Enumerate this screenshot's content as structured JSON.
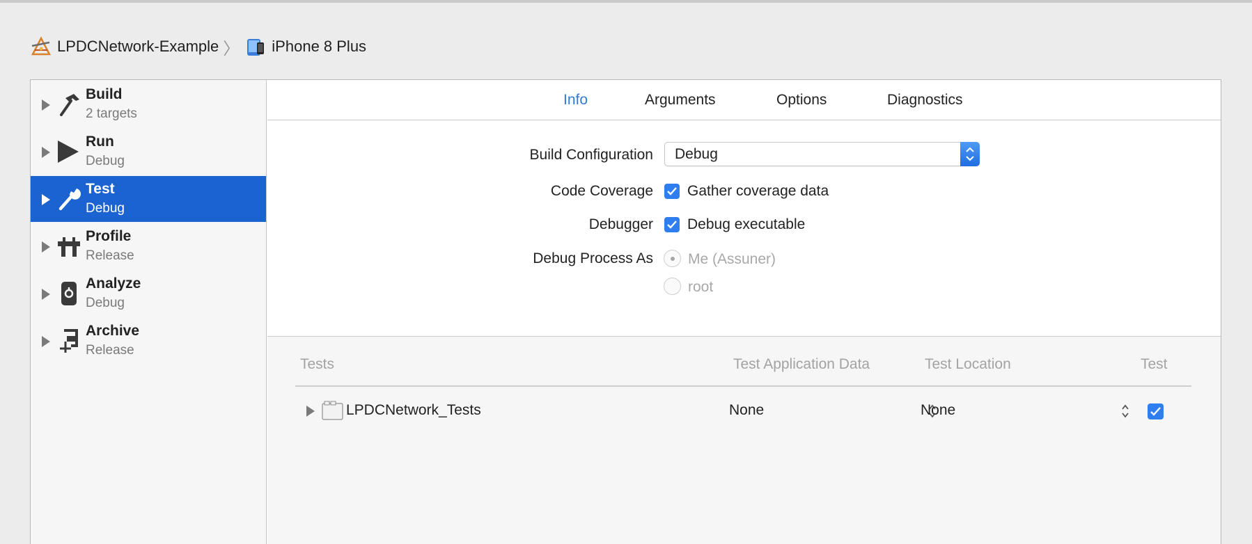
{
  "breadcrumb": {
    "project": "LPDCNetwork-Example",
    "separator": "〉",
    "device": "iPhone 8 Plus"
  },
  "sidebar": {
    "items": [
      {
        "name": "Build",
        "sub": "2 targets",
        "icon": "hammer-icon"
      },
      {
        "name": "Run",
        "sub": "Debug",
        "icon": "play-icon"
      },
      {
        "name": "Test",
        "sub": "Debug",
        "icon": "wrench-icon",
        "selected": true
      },
      {
        "name": "Profile",
        "sub": "Release",
        "icon": "caliper-icon"
      },
      {
        "name": "Analyze",
        "sub": "Debug",
        "icon": "analyze-icon"
      },
      {
        "name": "Archive",
        "sub": "Release",
        "icon": "clamp-icon"
      }
    ]
  },
  "tabs": [
    {
      "label": "Info",
      "active": true
    },
    {
      "label": "Arguments"
    },
    {
      "label": "Options"
    },
    {
      "label": "Diagnostics"
    }
  ],
  "info": {
    "build_configuration": {
      "label": "Build Configuration",
      "value": "Debug"
    },
    "code_coverage": {
      "label": "Code Coverage",
      "checkbox_label": "Gather coverage data",
      "checked": true
    },
    "debugger": {
      "label": "Debugger",
      "checkbox_label": "Debug executable",
      "checked": true
    },
    "debug_process_as": {
      "label": "Debug Process As",
      "options": [
        {
          "label": "Me (Assuner)",
          "selected": true,
          "disabled": true
        },
        {
          "label": "root",
          "selected": false,
          "disabled": true
        }
      ]
    }
  },
  "tests_table": {
    "columns": [
      "Tests",
      "Test Application Data",
      "Test Location",
      "Test"
    ],
    "rows": [
      {
        "name": "LPDCNetwork_Tests",
        "app_data": "None",
        "location": "None",
        "enabled": true
      }
    ]
  },
  "colors": {
    "accent": "#2f7bd6",
    "selection": "#1b63d1",
    "checkbox": "#2f7ef0"
  }
}
